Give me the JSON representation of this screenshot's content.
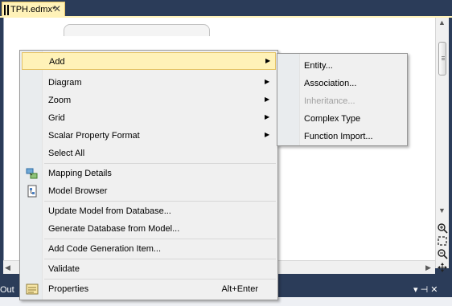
{
  "tab": {
    "title": "TPH.edmx*",
    "close_glyph": "✕"
  },
  "outline_panel": {
    "title": "Out",
    "controls": "▾ ⊣ ✕"
  },
  "icons": {
    "tab-close": "close-icon",
    "pin": "pin-icon",
    "mapping_details": "mapping-details-icon",
    "model_browser": "model-browser-icon",
    "properties": "properties-icon",
    "zoom_in": "zoom-in-icon",
    "zoom_fit": "zoom-to-fit-icon",
    "zoom_out": "zoom-out-icon",
    "pan": "pan-icon"
  },
  "context_menu": {
    "items": [
      {
        "label": "Add",
        "has_submenu": true,
        "highlighted": true
      },
      {
        "label": "Diagram",
        "has_submenu": true
      },
      {
        "label": "Zoom",
        "has_submenu": true
      },
      {
        "label": "Grid",
        "has_submenu": true
      },
      {
        "label": "Scalar Property Format",
        "has_submenu": true
      },
      {
        "label": "Select All"
      },
      {
        "label": "Mapping Details"
      },
      {
        "label": "Model Browser"
      },
      {
        "label": "Update Model from Database..."
      },
      {
        "label": "Generate Database from Model..."
      },
      {
        "label": "Add Code Generation Item..."
      },
      {
        "label": "Validate"
      },
      {
        "label": "Properties",
        "shortcut": "Alt+Enter"
      }
    ]
  },
  "add_submenu": {
    "items": [
      {
        "label": "Entity...",
        "enabled": true
      },
      {
        "label": "Association...",
        "enabled": true
      },
      {
        "label": "Inheritance...",
        "enabled": false
      },
      {
        "label": "Complex Type",
        "enabled": true
      },
      {
        "label": "Function Import...",
        "enabled": true
      }
    ]
  },
  "colors": {
    "highlight": "#fff2b8",
    "highlight_border": "#e5c365",
    "chrome": "#2b3c59",
    "disabled_text": "#a0a0a0"
  }
}
